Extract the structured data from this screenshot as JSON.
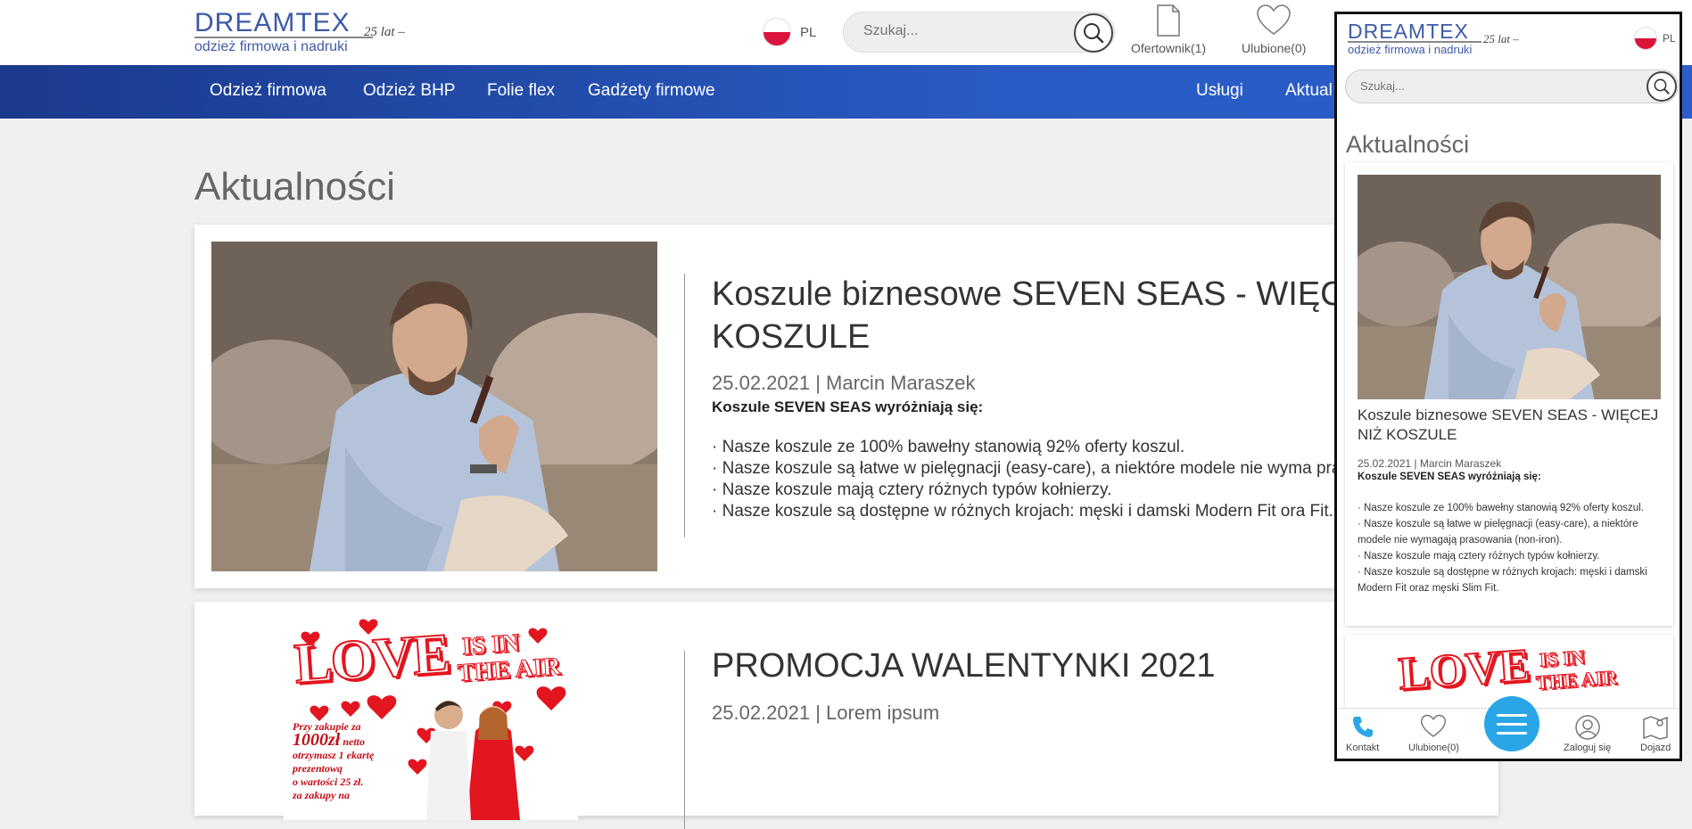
{
  "header": {
    "logo": {
      "brand_a": "DREAM",
      "brand_b": "TEX",
      "tagline": "odzież firmowa i nadruki",
      "years": "25 lat –"
    },
    "lang": "PL",
    "search_placeholder": "Szukaj...",
    "offer_label": "Ofertownik(1)",
    "favorites_label": "Ulubione(0)"
  },
  "nav": {
    "items": [
      "Odzież firmowa",
      "Odzież BHP",
      "Folie flex",
      "Gadżety firmowe"
    ],
    "right_items": [
      "Usługi",
      "Aktual"
    ]
  },
  "page_title": "Aktualności",
  "articles": [
    {
      "title": "Koszule biznesowe SEVEN SEAS - WIĘC KOSZULE",
      "meta": "25.02.2021 | Marcin Maraszek",
      "lead": "Koszule SEVEN SEAS wyróżniają się:",
      "bullets": [
        "·  Nasze koszule ze 100% bawełny stanowią 92% oferty koszul.",
        "·  Nasze koszule są łatwe w pielęgnacji (easy-care), a niektóre modele nie wyma prasowania (non-iron).",
        "·  Nasze koszule mają cztery różnych typów kołnierzy.",
        "·  Nasze koszule są dostępne w różnych krojach: męski i damski Modern Fit ora Fit."
      ]
    },
    {
      "title": "PROMOCJA WALENTYNKI 2021",
      "meta": "25.02.2021 | Lorem ipsum",
      "image_text": {
        "love": "LOVE",
        "is_in": "IS IN",
        "the_air": "THE AIR",
        "promo": "Przy zakupie za",
        "amount": "1000zł",
        "promo2": "netto",
        "promo3": "otrzymasz 1 ekartę",
        "promo4": "prezentową",
        "promo5": "o wartości 25 zł.",
        "promo6": "za zakupy na"
      }
    }
  ],
  "mobile": {
    "lang": "PL",
    "search_placeholder": "Szukaj...",
    "title": "Aktualności",
    "article": {
      "title": "Koszule biznesowe SEVEN SEAS - WIĘCEJ NIŻ KOSZULE",
      "meta": "25.02.2021 | Marcin Maraszek",
      "lead": "Koszule SEVEN SEAS wyróżniają się:",
      "bullets": [
        "·  Nasze koszule ze 100% bawełny stanowią 92% oferty koszul.",
        "·  Nasze koszule są łatwe w pielęgnacji (easy-care), a niektóre modele nie wymagają prasowania (non-iron).",
        "·  Nasze koszule mają cztery różnych typów kołnierzy.",
        "·  Nasze koszule są dostępne w różnych krojach: męski i damski Modern Fit oraz męski Slim Fit."
      ]
    },
    "bottom_bar": {
      "contact": "Kontakt",
      "favorites": "Ulubione(0)",
      "login": "Zaloguj się",
      "directions": "Dojazd"
    }
  },
  "colors": {
    "brand": "#3d5aa8",
    "nav_start": "#1a3a8c",
    "nav_end": "#2b5ec8",
    "menu_button": "#2aa6e6",
    "love_red": "#e3151f"
  }
}
